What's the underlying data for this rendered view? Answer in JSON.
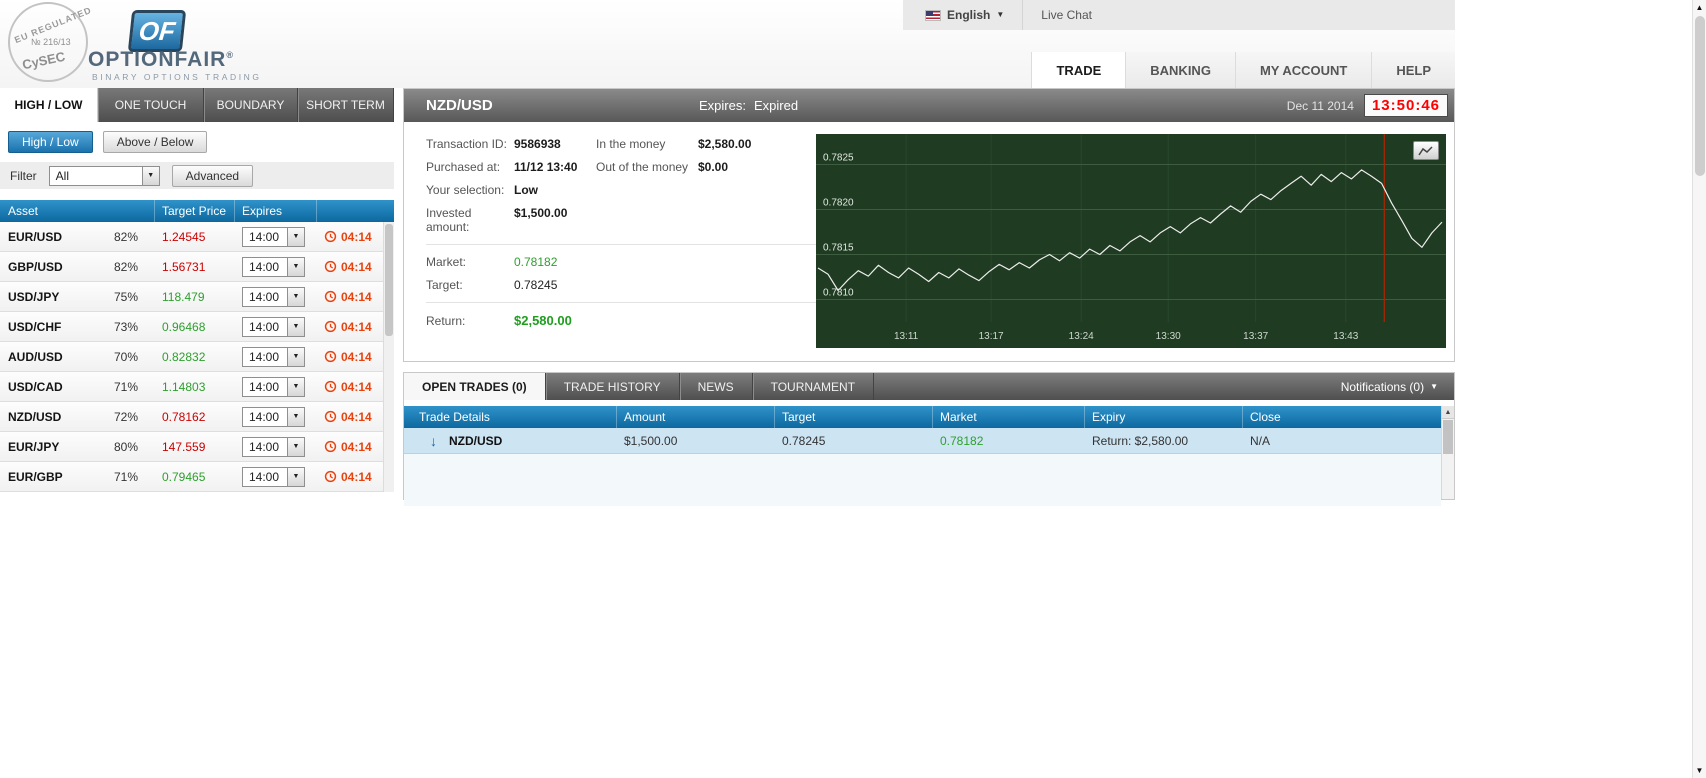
{
  "colors": {
    "accent_blue": "#1179b5",
    "up_green": "#2da02d",
    "down_red": "#cb0000",
    "clock_red": "#ff0000",
    "chart_bg": "#1f3b21",
    "countdown_orange": "#e8430e"
  },
  "header": {
    "badge": {
      "top": "EU REGULATED",
      "number": "№ 216/13",
      "bottom": "CySEC"
    },
    "logo": {
      "mark": "OF",
      "brand": "OPTIONFAIR",
      "reg": "®",
      "tagline": "BINARY OPTIONS TRADING"
    },
    "language": {
      "label": "English"
    },
    "live_chat": "Live Chat",
    "nav": [
      {
        "label": "TRADE"
      },
      {
        "label": "BANKING"
      },
      {
        "label": "MY ACCOUNT"
      },
      {
        "label": "HELP"
      }
    ]
  },
  "left_panel": {
    "tabs": [
      {
        "label": "HIGH / LOW"
      },
      {
        "label": "ONE TOUCH"
      },
      {
        "label": "BOUNDARY"
      },
      {
        "label": "SHORT TERM"
      }
    ],
    "subtabs": [
      {
        "label": "High / Low"
      },
      {
        "label": "Above / Below"
      }
    ],
    "filter": {
      "label": "Filter",
      "value": "All",
      "advanced_label": "Advanced"
    },
    "asset_table": {
      "headers": {
        "asset": "Asset",
        "target_price": "Target Price",
        "expires": "Expires"
      },
      "rows": [
        {
          "asset": "EUR/USD",
          "payout": "82%",
          "price": "1.24545",
          "trend": "down",
          "expiry": "14:00",
          "countdown": "04:14"
        },
        {
          "asset": "GBP/USD",
          "payout": "82%",
          "price": "1.56731",
          "trend": "down",
          "expiry": "14:00",
          "countdown": "04:14"
        },
        {
          "asset": "USD/JPY",
          "payout": "75%",
          "price": "118.479",
          "trend": "up",
          "expiry": "14:00",
          "countdown": "04:14"
        },
        {
          "asset": "USD/CHF",
          "payout": "73%",
          "price": "0.96468",
          "trend": "up",
          "expiry": "14:00",
          "countdown": "04:14"
        },
        {
          "asset": "AUD/USD",
          "payout": "70%",
          "price": "0.82832",
          "trend": "up",
          "expiry": "14:00",
          "countdown": "04:14"
        },
        {
          "asset": "USD/CAD",
          "payout": "71%",
          "price": "1.14803",
          "trend": "up",
          "expiry": "14:00",
          "countdown": "04:14"
        },
        {
          "asset": "NZD/USD",
          "payout": "72%",
          "price": "0.78162",
          "trend": "down",
          "expiry": "14:00",
          "countdown": "04:14"
        },
        {
          "asset": "EUR/JPY",
          "payout": "80%",
          "price": "147.559",
          "trend": "down",
          "expiry": "14:00",
          "countdown": "04:14"
        },
        {
          "asset": "EUR/GBP",
          "payout": "71%",
          "price": "0.79465",
          "trend": "up",
          "expiry": "14:00",
          "countdown": "04:14"
        }
      ]
    }
  },
  "trade_panel": {
    "symbol": "NZD/USD",
    "expires_label": "Expires:",
    "expires_value": "Expired",
    "date": "Dec 11 2014",
    "time": "13:50:46",
    "fields": {
      "transaction_id_label": "Transaction ID:",
      "transaction_id": "9586938",
      "in_money_label": "In the money",
      "in_money": "$2,580.00",
      "purchased_label": "Purchased at:",
      "purchased": "11/12 13:40",
      "out_money_label": "Out of the money",
      "out_money": "$0.00",
      "selection_label": "Your selection:",
      "selection": "Low",
      "invested_label": "Invested amount:",
      "invested": "$1,500.00",
      "market_label": "Market:",
      "market": "0.78182",
      "target_label": "Target:",
      "target": "0.78245",
      "return_label": "Return:",
      "return_value": "$2,580.00"
    }
  },
  "chart_data": {
    "type": "line",
    "title": "NZD/USD intraday price",
    "legend": [],
    "grid": true,
    "y_range": [
      0.78075,
      0.78275
    ],
    "y_gridlines": [
      0.7825,
      0.782,
      0.7815,
      0.781
    ],
    "y_labels": [
      "0.7825",
      "0.7820",
      "0.7815",
      "0.7810"
    ],
    "x_ticks": [
      "13:11",
      "13:17",
      "13:24",
      "13:30",
      "13:37",
      "13:43"
    ],
    "x_tick_fracs": [
      0.143,
      0.278,
      0.421,
      0.559,
      0.698,
      0.841
    ],
    "expiry_line_frac": 0.902,
    "values": [
      0.78135,
      0.78128,
      0.7811,
      0.78122,
      0.78132,
      0.78126,
      0.78138,
      0.7813,
      0.78124,
      0.78135,
      0.78128,
      0.7812,
      0.7813,
      0.78124,
      0.78134,
      0.78127,
      0.78121,
      0.78131,
      0.78139,
      0.78133,
      0.78141,
      0.78135,
      0.78144,
      0.7815,
      0.78143,
      0.78152,
      0.78146,
      0.78156,
      0.7815,
      0.7816,
      0.78154,
      0.78164,
      0.78171,
      0.78164,
      0.78174,
      0.78181,
      0.78174,
      0.78184,
      0.78191,
      0.78185,
      0.78195,
      0.78204,
      0.78197,
      0.78209,
      0.78217,
      0.78211,
      0.78221,
      0.78229,
      0.78237,
      0.78227,
      0.78239,
      0.78231,
      0.78241,
      0.78234,
      0.78244,
      0.78237,
      0.78229,
      0.78207,
      0.78188,
      0.78168,
      0.78158,
      0.78174,
      0.78186
    ]
  },
  "bottom_panel": {
    "tabs": [
      {
        "label": "OPEN TRADES (0)"
      },
      {
        "label": "TRADE HISTORY"
      },
      {
        "label": "NEWS"
      },
      {
        "label": "TOURNAMENT"
      }
    ],
    "notifications": "Notifications (0)",
    "table": {
      "headers": {
        "details": "Trade Details",
        "amount": "Amount",
        "target": "Target",
        "market": "Market",
        "expiry": "Expiry",
        "close": "Close"
      },
      "rows": [
        {
          "asset": "NZD/USD",
          "direction": "down",
          "amount": "$1,500.00",
          "target": "0.78245",
          "market": "0.78182",
          "expiry": "Return: $2,580.00",
          "close": "N/A"
        }
      ]
    }
  }
}
